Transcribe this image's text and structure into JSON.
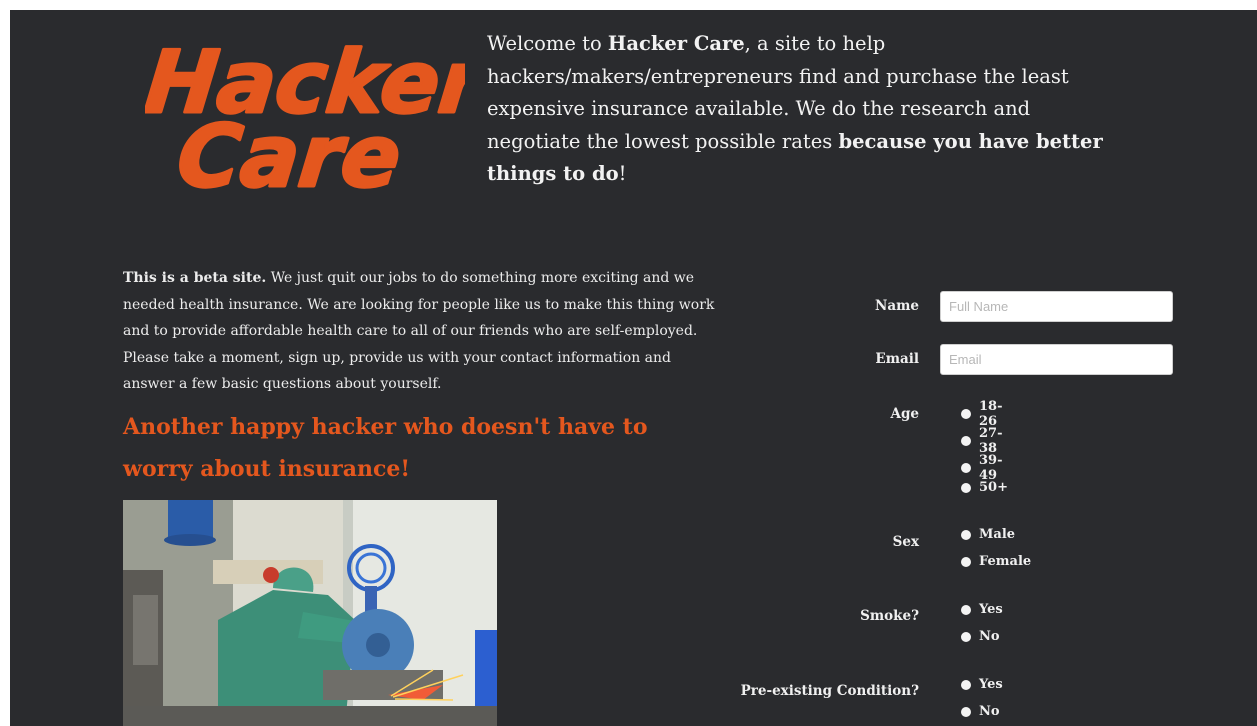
{
  "header": {
    "logo_text": [
      "Hacker",
      "Care"
    ],
    "welcome": {
      "part1": "Welcome to ",
      "brand": "Hacker Care",
      "part2": ", a site to help hackers/makers/entrepreneurs find and purchase the least expensive insurance available. We do the research and negotiate the lowest possible rates ",
      "emphasis": "because you have better things to do",
      "part3": "!"
    }
  },
  "intro": {
    "bold": "This is a beta site.",
    "text": " We just quit our jobs to do something more exciting and we needed health insurance. We are looking for people like us to make this thing work and to provide affordable health care to all of our friends who are self-employed. Please take a moment, sign up, provide us with your contact information and answer a few basic questions about yourself."
  },
  "tagline": "Another happy hacker who doesn't have to worry about insurance!",
  "form": {
    "name": {
      "label": "Name",
      "placeholder": "Full Name"
    },
    "email": {
      "label": "Email",
      "placeholder": "Email"
    },
    "age": {
      "label": "Age",
      "options": [
        "18-26",
        "27-38",
        "39-49",
        "50+"
      ]
    },
    "sex": {
      "label": "Sex",
      "options": [
        "Male",
        "Female"
      ]
    },
    "smoke": {
      "label": "Smoke?",
      "options": [
        "Yes",
        "No"
      ]
    },
    "preexisting": {
      "label": "Pre-existing Condition?",
      "options": [
        "Yes",
        "No"
      ]
    }
  },
  "colors": {
    "background": "#2a2b2e",
    "accent": "#e4571e",
    "text": "#f0f0f0"
  }
}
